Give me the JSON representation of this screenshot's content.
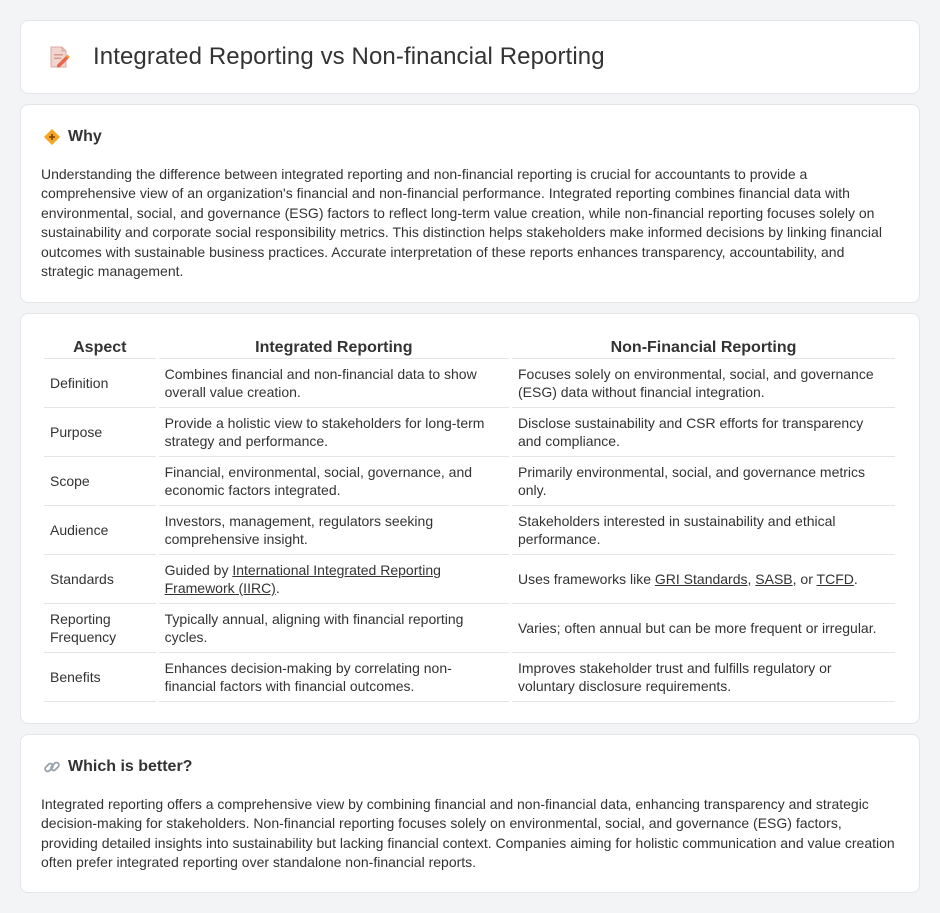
{
  "header": {
    "title": "Integrated Reporting vs Non-financial Reporting",
    "icon": "document-pencil-icon"
  },
  "why": {
    "heading": "Why",
    "icon": "diamond-sign-icon",
    "text": "Understanding the difference between integrated reporting and non-financial reporting is crucial for accountants to provide a comprehensive view of an organization's financial and non-financial performance. Integrated reporting combines financial data with environmental, social, and governance (ESG) factors to reflect long-term value creation, while non-financial reporting focuses solely on sustainability and corporate social responsibility metrics. This distinction helps stakeholders make informed decisions by linking financial outcomes with sustainable business practices. Accurate interpretation of these reports enhances transparency, accountability, and strategic management."
  },
  "table": {
    "headers": [
      "Aspect",
      "Integrated Reporting",
      "Non-Financial Reporting"
    ],
    "rows": [
      {
        "aspect": "Definition",
        "integrated": "Combines financial and non-financial data to show overall value creation.",
        "nonfinancial": "Focuses solely on environmental, social, and governance (ESG) data without financial integration."
      },
      {
        "aspect": "Purpose",
        "integrated": "Provide a holistic view to stakeholders for long-term strategy and performance.",
        "nonfinancial": "Disclose sustainability and CSR efforts for transparency and compliance."
      },
      {
        "aspect": "Scope",
        "integrated": "Financial, environmental, social, governance, and economic factors integrated.",
        "nonfinancial": "Primarily environmental, social, and governance metrics only."
      },
      {
        "aspect": "Audience",
        "integrated": "Investors, management, regulators seeking comprehensive insight.",
        "nonfinancial": "Stakeholders interested in sustainability and ethical performance."
      },
      {
        "aspect": "Standards",
        "integrated_prefix": "Guided by ",
        "integrated_link": "International Integrated Reporting Framework (IIRC)",
        "integrated_suffix": ".",
        "nonfinancial_prefix": "Uses frameworks like ",
        "nonfinancial_link1": "GRI Standards",
        "nonfinancial_sep1": ", ",
        "nonfinancial_link2": "SASB",
        "nonfinancial_sep2": ", or ",
        "nonfinancial_link3": "TCFD",
        "nonfinancial_suffix": "."
      },
      {
        "aspect": "Reporting Frequency",
        "integrated": "Typically annual, aligning with financial reporting cycles.",
        "nonfinancial": "Varies; often annual but can be more frequent or irregular."
      },
      {
        "aspect": "Benefits",
        "integrated": "Enhances decision-making by correlating non-financial factors with financial outcomes.",
        "nonfinancial": "Improves stakeholder trust and fulfills regulatory or voluntary disclosure requirements."
      }
    ]
  },
  "better": {
    "heading": "Which is better?",
    "icon": "link-icon",
    "text": "Integrated reporting offers a comprehensive view by combining financial and non-financial data, enhancing transparency and strategic decision-making for stakeholders. Non-financial reporting focuses solely on environmental, social, and governance (ESG) factors, providing detailed insights into sustainability but lacking financial context. Companies aiming for holistic communication and value creation often prefer integrated reporting over standalone non-financial reports."
  },
  "colors": {
    "background": "#f3f4f6",
    "card": "#ffffff",
    "text": "#333333",
    "border": "#e3e5e8",
    "accent": "#f5a623"
  }
}
